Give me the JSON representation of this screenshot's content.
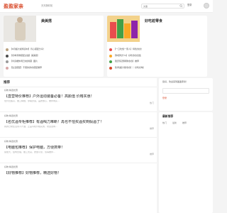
{
  "header": {
    "logo": "盈盈家亲",
    "tagline": "天天随你找",
    "search_placeholder": "文章",
    "auth_label": "登录"
  },
  "cards": [
    {
      "title": "美美搭",
      "items": [
        "【6月超大模特身材】背心搭配分享！",
        "【冬季赤膊搭配必备】美美搭！",
        "【半身裙休闲日常穿搭】图片",
        "【生活搭配】不错的穿衣搭配推荐"
      ]
    },
    {
      "title": "好吃趁零食",
      "items": [
        "【一口吃饱一家人】特色零食！",
        "【你想吃什么】好吃零食合集",
        "【经济实惠网购零食】推荐",
        "【好吃超大箱零食】！好吃好喝！"
      ]
    }
  ],
  "feed": {
    "title": "推荐",
    "posts": [
      {
        "meta": "好物  精选优惠",
        "title": "【直营特价推荐】户外运动装备必备！高颜值  价格实惠！",
        "excerpt": "性价比超高，做工精细，穿着舒适，品质放心，推荐购买...",
        "actions": "热门"
      },
      {
        "meta": "好物  精选优惠",
        "title": "【名优酒专柜推荐】有酒喝力难断！再也不怕买酒买到假酒了！",
        "excerpt": "我的日常生活离不开酒，正品专柜价格实惠，欢迎选购...",
        "actions": "推荐"
      },
      {
        "meta": "好物  精选优惠",
        "title": "【电脑包推荐】保护电脑，方便携带！",
        "excerpt": "容量大，结构合理，做工优良，质量可靠，值得推荐...",
        "actions": "推荐"
      },
      {
        "meta": "好物  精选优惠",
        "title": "【好物推荐】好物推荐，精选好物！",
        "excerpt": "",
        "actions": ""
      }
    ]
  },
  "side": {
    "welcome": "您好，欢迎来到盈盈家亲！",
    "login_prompt": "登录",
    "section_title": "最新推荐",
    "tags": [
      "热门",
      "最新",
      "推荐"
    ]
  }
}
